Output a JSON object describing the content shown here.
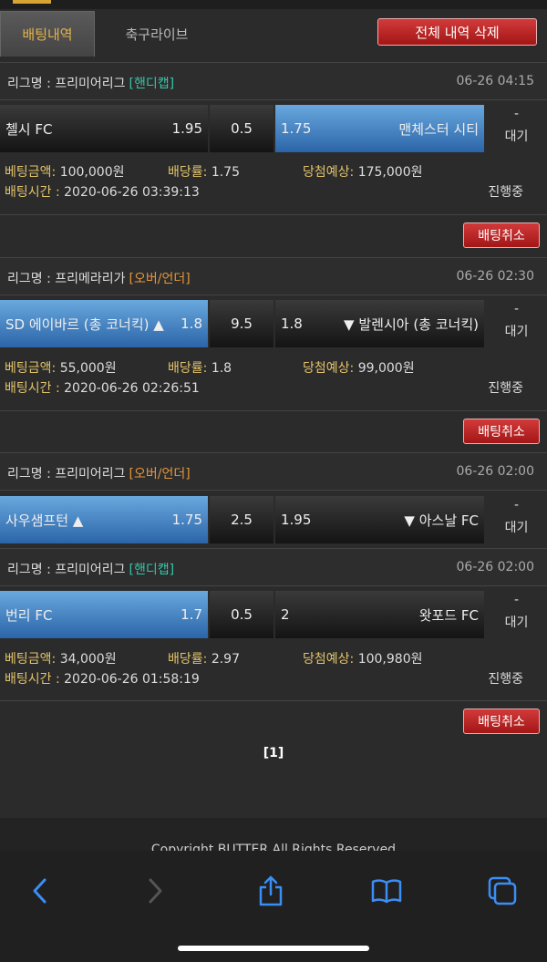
{
  "tabs": {
    "active_label": "배팅내역",
    "inactive_label": "축구라이브",
    "delete_all_label": "전체 내역 삭제"
  },
  "bets": [
    {
      "league_prefix": "리그명 : 프리미어리그",
      "league_type": "[핸디캡]",
      "datetime": "06-26 04:15",
      "home_team": "첼시 FC",
      "home_odds": "1.95",
      "line": "0.5",
      "away_odds": "1.75",
      "away_team": "맨체스터 시티",
      "status_dash": "-",
      "status_text": "대기",
      "amount_label": "베팅금액:",
      "amount_value": "100,000원",
      "rate_label": "배당률:",
      "rate_value": "1.75",
      "expected_label": "당첨예상:",
      "expected_value": "175,000원",
      "time_label": "배팅시간 :",
      "time_value": "2020-06-26 03:39:13",
      "progress": "진행중",
      "cancel_label": "배팅취소"
    },
    {
      "league_prefix": "리그명 : 프리메라리가",
      "league_type": "[오버/언더]",
      "datetime": "06-26 02:30",
      "home_team": "SD 에이바르 (총 코너킥) ▲",
      "home_odds": "1.8",
      "line": "9.5",
      "away_odds": "1.8",
      "away_team": "▼ 발렌시아 (총 코너킥)",
      "status_dash": "-",
      "status_text": "대기",
      "amount_label": "베팅금액:",
      "amount_value": "55,000원",
      "rate_label": "배당률:",
      "rate_value": "1.8",
      "expected_label": "당첨예상:",
      "expected_value": "99,000원",
      "time_label": "배팅시간 :",
      "time_value": "2020-06-26 02:26:51",
      "progress": "진행중",
      "cancel_label": "배팅취소"
    },
    {
      "league_prefix": "리그명 : 프리미어리그",
      "league_type": "[오버/언더]",
      "datetime": "06-26 02:00",
      "home_team": "사우샘프턴 ▲",
      "home_odds": "1.75",
      "line": "2.5",
      "away_odds": "1.95",
      "away_team": "▼ 아스날 FC",
      "status_dash": "-",
      "status_text": "대기"
    },
    {
      "league_prefix": "리그명 : 프리미어리그",
      "league_type": "[핸디캡]",
      "datetime": "06-26 02:00",
      "home_team": "번리 FC",
      "home_odds": "1.7",
      "line": "0.5",
      "away_odds": "2",
      "away_team": "왓포드 FC",
      "status_dash": "-",
      "status_text": "대기",
      "amount_label": "베팅금액:",
      "amount_value": "34,000원",
      "rate_label": "배당률:",
      "rate_value": "2.97",
      "expected_label": "당첨예상:",
      "expected_value": "100,980원",
      "time_label": "배팅시간 :",
      "time_value": "2020-06-26 01:58:19",
      "progress": "진행중",
      "cancel_label": "배팅취소"
    }
  ],
  "pagination": {
    "label": "[1]"
  },
  "footer": {
    "copyright": "Copyright BUTTER All Rights Reserved"
  },
  "browser": {
    "icons": [
      "back-icon",
      "forward-icon",
      "share-icon",
      "bookmarks-icon",
      "tabs-icon"
    ]
  },
  "colors": {
    "accent": "#e3b34a",
    "handicap": "#35c6a8",
    "overunder": "#e3963a",
    "selected": "#3f82c6",
    "button": "#c02626"
  }
}
